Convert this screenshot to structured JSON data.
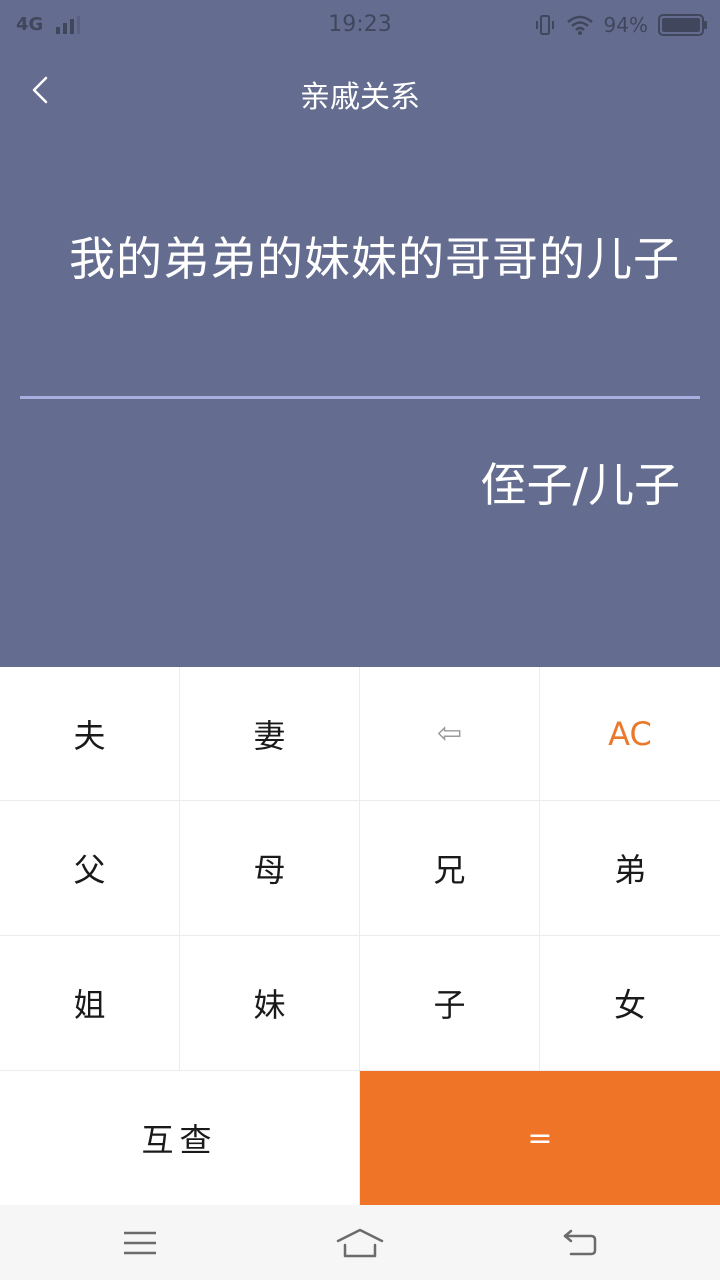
{
  "status_bar": {
    "network": "4G",
    "time": "19:23",
    "battery": "94%"
  },
  "header": {
    "title": "亲戚关系"
  },
  "display": {
    "expression": "我的弟弟的妹妹的哥哥的儿子",
    "result": "侄子/儿子"
  },
  "keypad": {
    "row1": [
      "夫",
      "妻",
      "⇦",
      "AC"
    ],
    "row2": [
      "父",
      "母",
      "兄",
      "弟"
    ],
    "row3": [
      "姐",
      "妹",
      "子",
      "女"
    ],
    "mutual": "互查",
    "equals": "="
  },
  "colors": {
    "header_bg": "#646d90",
    "accent_orange": "#f07428",
    "ac_text": "#ea7a2b",
    "divider": "#a9aedf"
  }
}
